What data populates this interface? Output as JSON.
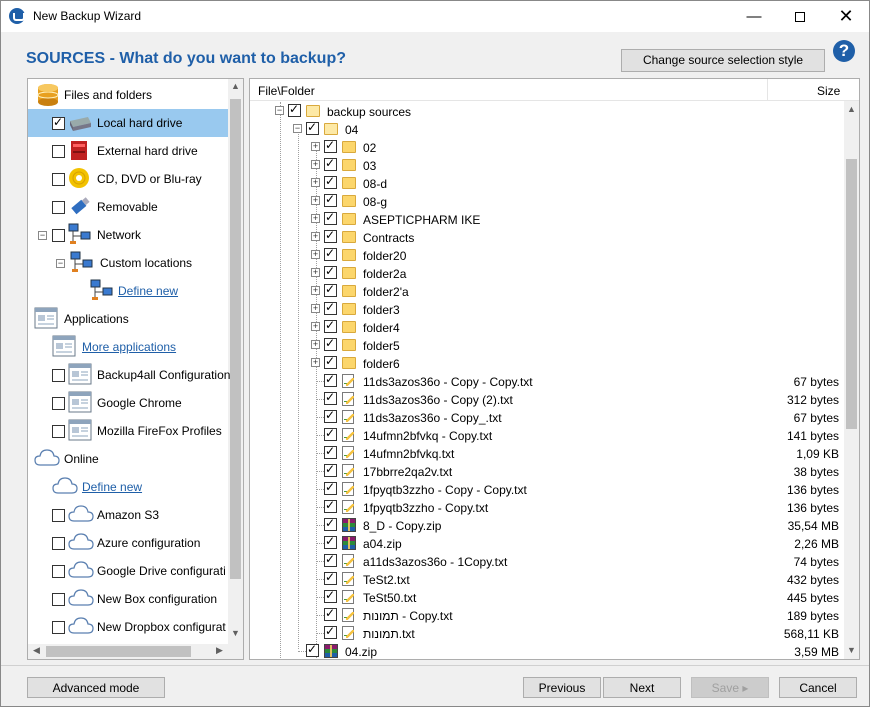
{
  "window": {
    "title": "New Backup Wizard",
    "minimize": "—",
    "close": "✕"
  },
  "heading": "SOURCES - What do you want to backup?",
  "change_style_button": "Change source selection style",
  "help": "?",
  "left_panel": {
    "items": [
      {
        "label": "Files and folders",
        "type": "category",
        "icon": "database-icon"
      },
      {
        "label": "Local hard drive",
        "type": "item",
        "checked": true,
        "selected": true,
        "icon": "hard-drive-icon"
      },
      {
        "label": "External hard drive",
        "type": "item",
        "checked": false,
        "icon": "external-drive-icon"
      },
      {
        "label": "CD, DVD or Blu-ray",
        "type": "item",
        "checked": false,
        "icon": "disc-icon"
      },
      {
        "label": "Removable",
        "type": "item",
        "checked": false,
        "icon": "usb-icon"
      },
      {
        "label": "Network",
        "type": "item",
        "checked": false,
        "expander": "−",
        "icon": "network-icon"
      },
      {
        "label": "Custom locations",
        "type": "item",
        "expander": "−",
        "icon": "network-icon"
      },
      {
        "label": "Define new",
        "type": "link",
        "icon": "network-icon"
      },
      {
        "label": "Applications",
        "type": "category",
        "icon": "application-icon"
      },
      {
        "label": "More applications",
        "type": "link",
        "icon": "application-icon"
      },
      {
        "label": "Backup4all Configuration",
        "type": "item",
        "checked": false,
        "icon": "application-icon"
      },
      {
        "label": "Google Chrome",
        "type": "item",
        "checked": false,
        "icon": "application-icon"
      },
      {
        "label": "Mozilla FireFox Profiles",
        "type": "item",
        "checked": false,
        "icon": "application-icon"
      },
      {
        "label": "Online",
        "type": "category",
        "icon": "cloud-icon"
      },
      {
        "label": "Define new",
        "type": "link",
        "icon": "cloud-icon"
      },
      {
        "label": "Amazon S3",
        "type": "item",
        "checked": false,
        "icon": "cloud-icon"
      },
      {
        "label": "Azure configuration",
        "type": "item",
        "checked": false,
        "icon": "cloud-icon"
      },
      {
        "label": "Google Drive configurati",
        "type": "item",
        "checked": false,
        "icon": "cloud-icon"
      },
      {
        "label": "New Box configuration",
        "type": "item",
        "checked": false,
        "icon": "cloud-icon"
      },
      {
        "label": "New Dropbox configurat",
        "type": "item",
        "checked": false,
        "icon": "cloud-icon"
      }
    ]
  },
  "right_panel": {
    "col_name": "File\\Folder",
    "col_size": "Size",
    "rows": [
      {
        "name": "backup sources",
        "kind": "folder",
        "expander": "−",
        "checked": true,
        "size": ""
      },
      {
        "name": "04",
        "kind": "folder",
        "expander": "−",
        "checked": true,
        "size": ""
      },
      {
        "name": "02",
        "kind": "folder",
        "expander": "+",
        "checked": true,
        "size": ""
      },
      {
        "name": "03",
        "kind": "folder",
        "expander": "+",
        "checked": true,
        "size": ""
      },
      {
        "name": "08-d",
        "kind": "folder",
        "expander": "+",
        "checked": true,
        "size": ""
      },
      {
        "name": "08-g",
        "kind": "folder",
        "expander": "+",
        "checked": true,
        "size": ""
      },
      {
        "name": "ASEPTICPHARM IKE",
        "kind": "folder",
        "expander": "+",
        "checked": true,
        "size": ""
      },
      {
        "name": "Contracts",
        "kind": "folder",
        "expander": "+",
        "checked": true,
        "size": ""
      },
      {
        "name": "folder20",
        "kind": "folder",
        "expander": "+",
        "checked": true,
        "size": ""
      },
      {
        "name": "folder2a",
        "kind": "folder",
        "expander": "+",
        "checked": true,
        "size": ""
      },
      {
        "name": "folder2'a",
        "kind": "folder",
        "expander": "+",
        "checked": true,
        "size": ""
      },
      {
        "name": "folder3",
        "kind": "folder",
        "expander": "+",
        "checked": true,
        "size": ""
      },
      {
        "name": "folder4",
        "kind": "folder",
        "expander": "+",
        "checked": true,
        "size": ""
      },
      {
        "name": "folder5",
        "kind": "folder",
        "expander": "+",
        "checked": true,
        "size": ""
      },
      {
        "name": "folder6",
        "kind": "folder",
        "expander": "+",
        "checked": true,
        "size": ""
      },
      {
        "name": "11ds3azos36o - Copy - Copy.txt",
        "kind": "txt",
        "checked": true,
        "size": "67 bytes"
      },
      {
        "name": "11ds3azos36o - Copy (2).txt",
        "kind": "txt",
        "checked": true,
        "size": "312 bytes"
      },
      {
        "name": "11ds3azos36o - Copy_.txt",
        "kind": "txt",
        "checked": true,
        "size": "67 bytes"
      },
      {
        "name": "14ufmn2bfvkq - Copy.txt",
        "kind": "txt",
        "checked": true,
        "size": "141 bytes"
      },
      {
        "name": "14ufmn2bfvkq.txt",
        "kind": "txt",
        "checked": true,
        "size": "1,09 KB"
      },
      {
        "name": "17bbrre2qa2v.txt",
        "kind": "txt",
        "checked": true,
        "size": "38 bytes"
      },
      {
        "name": "1fpyqtb3zzho - Copy - Copy.txt",
        "kind": "txt",
        "checked": true,
        "size": "136 bytes"
      },
      {
        "name": "1fpyqtb3zzho - Copy.txt",
        "kind": "txt",
        "checked": true,
        "size": "136 bytes"
      },
      {
        "name": "8_D - Copy.zip",
        "kind": "zip",
        "checked": true,
        "size": "35,54 MB"
      },
      {
        "name": "a04.zip",
        "kind": "zip",
        "checked": true,
        "size": "2,26 MB"
      },
      {
        "name": "a11ds3azos36o - 1Copy.txt",
        "kind": "txt",
        "checked": true,
        "size": "74 bytes"
      },
      {
        "name": "TeSt2.txt",
        "kind": "txt",
        "checked": true,
        "size": "432 bytes"
      },
      {
        "name": "TeSt50.txt",
        "kind": "txt",
        "checked": true,
        "size": "445 bytes"
      },
      {
        "name": "תמונות - Copy.txt",
        "kind": "txt",
        "checked": true,
        "size": "189 bytes"
      },
      {
        "name": "תמונות.txt",
        "kind": "txt",
        "checked": true,
        "size": "568,11 KB"
      },
      {
        "name": "04.zip",
        "kind": "zip",
        "checked": true,
        "size": "3,59 MB"
      }
    ]
  },
  "footer": {
    "advanced_mode": "Advanced mode",
    "previous": "Previous",
    "next": "Next",
    "save": "Save",
    "cancel": "Cancel"
  }
}
